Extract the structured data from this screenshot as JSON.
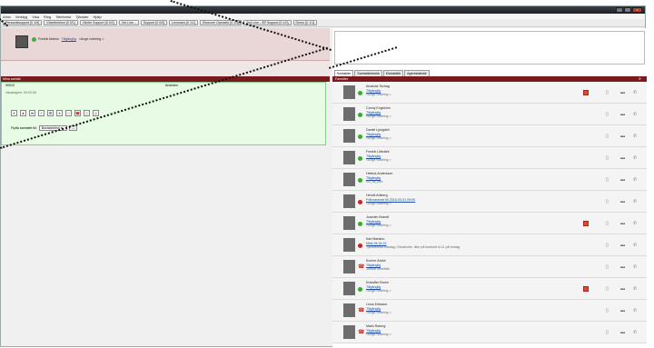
{
  "menu": [
    "Arkiv",
    "Verktyg",
    "Visa",
    "Ring",
    "Telefonist",
    "Tjänster",
    "Hjälp"
  ],
  "queues": [
    "Personalsupport [0 1/0]",
    "Växeltelefoni [0 0/1]",
    "Växter Support [0 0/2]",
    "3rd Line...",
    "Support [0 0/0]",
    "Leverans [0 1/1]",
    "Ekonomi Operatör [0 1/1]",
    "2nd Line - ÅP Support [0 1/0]",
    "Demo [0 1/1]"
  ],
  "profile": {
    "name": "Fredrik Malms",
    "status": "Tillgänglig",
    "note": "<Ange notering >"
  },
  "call": {
    "panel_title": "Mina samtal",
    "number": "90010",
    "state": "Ansluten",
    "duration": "Varaktighet: 00:00:05",
    "move_label": "Flytta samtalet till:",
    "move_target": "Bordstelefon",
    "go_label": "..."
  },
  "tools": [
    "⏸",
    "●",
    "➦",
    "+",
    "⊞",
    "⏸",
    "☏",
    "☎",
    "▤",
    "▦"
  ],
  "tabs": [
    "Kontakter",
    "Samtalshistorik",
    "Köstatistik",
    "Agentstatistik"
  ],
  "favorites_title": "Favoriter",
  "contacts": [
    {
      "name": "Amanda Tochag",
      "status": "Tillgänglig",
      "note": "<Ange notering >",
      "state": "green",
      "cal": true
    },
    {
      "name": "Conny Engström",
      "status": "Tillgänglig",
      "note": "<Ange notering >",
      "state": "green",
      "cal": false
    },
    {
      "name": "Daniel Ljungdell",
      "status": "Tillgänglig",
      "note": "<Ange notering >",
      "state": "green",
      "cal": false
    },
    {
      "name": "Fredrik Lilledahl",
      "status": "Tillgänglig",
      "note": "<Ange notering >",
      "state": "green",
      "cal": false
    },
    {
      "name": "Helena Andersson",
      "status": "Tillgänglig",
      "note": "Rö_ds_lore",
      "state": "green",
      "cal": false
    },
    {
      "name": "Henrik Ahlberg",
      "status": "Frånvarande till 2016-03-01 09:00",
      "note": "<Ange notering >",
      "state": "red",
      "cal": false
    },
    {
      "name": "Joachim Brandt",
      "status": "Tillgänglig",
      "note": "<Ange notering >",
      "state": "green",
      "cal": true
    },
    {
      "name": "Karl Mariano",
      "status": "Möte till 16:15",
      "note": "Tjänsteresa onsdag i Stockholm, åter på kontoret kl.11 på fredag.",
      "state": "red",
      "cal": false
    },
    {
      "name": "Kocher Abdul",
      "status": "Tillgänglig",
      "note": "Jobbar hemifrån",
      "state": "phone",
      "cal": false
    },
    {
      "name": "Kristoffer Bruhn",
      "status": "Tillgänglig",
      "note": "<Ange notering >",
      "state": "green",
      "cal": true
    },
    {
      "name": "Linus Eriksson",
      "status": "Tillgänglig",
      "note": "<Ange notering >",
      "state": "phone",
      "cal": false
    },
    {
      "name": "Malin Roberg",
      "status": "Tillgänglig",
      "note": "<Ange notering >",
      "state": "phone",
      "cal": false
    }
  ]
}
